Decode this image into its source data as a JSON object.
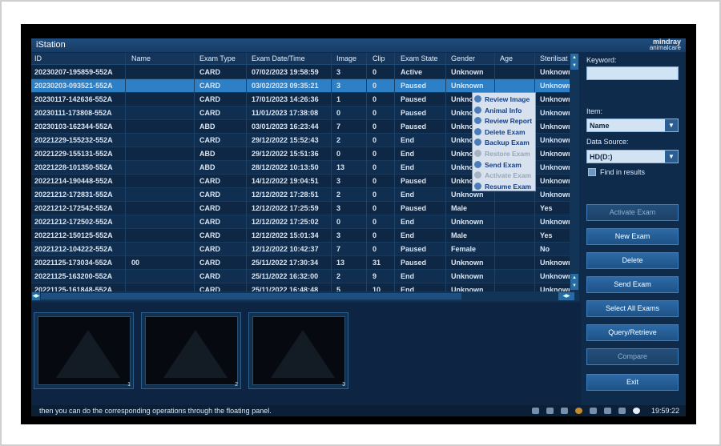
{
  "window": {
    "title": "iStation",
    "logo_line1": "mindray",
    "logo_line2": "animalcare"
  },
  "table": {
    "columns": [
      "ID",
      "Name",
      "Exam Type",
      "Exam Date/Time",
      "Image",
      "Clip",
      "Exam State",
      "Gender",
      "Age",
      "Sterilisat"
    ],
    "rows": [
      [
        "20230207-195859-552A",
        "",
        "CARD",
        "07/02/2023 19:58:59",
        "3",
        "0",
        "Active",
        "Unknown",
        "",
        "Unknown"
      ],
      [
        "20230203-093521-552A",
        "",
        "CARD",
        "03/02/2023 09:35:21",
        "3",
        "0",
        "Paused",
        "Unknown",
        "",
        "Unknown"
      ],
      [
        "20230117-142636-552A",
        "",
        "CARD",
        "17/01/2023 14:26:36",
        "1",
        "0",
        "Paused",
        "Unkno",
        "",
        "Unknown"
      ],
      [
        "20230111-173808-552A",
        "",
        "CARD",
        "11/01/2023 17:38:08",
        "0",
        "0",
        "Paused",
        "Unkno",
        "",
        "Unknown"
      ],
      [
        "20230103-162344-552A",
        "",
        "ABD",
        "03/01/2023 16:23:44",
        "7",
        "0",
        "Paused",
        "Unkno",
        "",
        "Unknown"
      ],
      [
        "20221229-155232-552A",
        "",
        "CARD",
        "29/12/2022 15:52:43",
        "2",
        "0",
        "End",
        "Unkno",
        "",
        "Unknown"
      ],
      [
        "20221229-155131-552A",
        "",
        "ABD",
        "29/12/2022 15:51:36",
        "0",
        "0",
        "End",
        "Unkno",
        "",
        "Unknown"
      ],
      [
        "20221228-101350-552A",
        "",
        "ABD",
        "28/12/2022 10:13:50",
        "13",
        "0",
        "End",
        "Unkno",
        "",
        "Unknown"
      ],
      [
        "20221214-190448-552A",
        "",
        "CARD",
        "14/12/2022 19:04:51",
        "3",
        "0",
        "Paused",
        "Unkno",
        "",
        "Unknown"
      ],
      [
        "20221212-172831-552A",
        "",
        "CARD",
        "12/12/2022 17:28:51",
        "2",
        "0",
        "End",
        "Unknown",
        "",
        "Unknown"
      ],
      [
        "20221212-172542-552A",
        "",
        "CARD",
        "12/12/2022 17:25:59",
        "3",
        "0",
        "Paused",
        "Male",
        "",
        "Yes"
      ],
      [
        "20221212-172502-552A",
        "",
        "CARD",
        "12/12/2022 17:25:02",
        "0",
        "0",
        "End",
        "Unknown",
        "",
        "Unknown"
      ],
      [
        "20221212-150125-552A",
        "",
        "CARD",
        "12/12/2022 15:01:34",
        "3",
        "0",
        "End",
        "Male",
        "",
        "Yes"
      ],
      [
        "20221212-104222-552A",
        "",
        "CARD",
        "12/12/2022 10:42:37",
        "7",
        "0",
        "Paused",
        "Female",
        "",
        "No"
      ],
      [
        "20221125-173034-552A",
        "00",
        "CARD",
        "25/11/2022 17:30:34",
        "13",
        "31",
        "Paused",
        "Unknown",
        "",
        "Unknown"
      ],
      [
        "20221125-163200-552A",
        "",
        "CARD",
        "25/11/2022 16:32:00",
        "2",
        "9",
        "End",
        "Unknown",
        "",
        "Unknown"
      ],
      [
        "20221125-161848-552A",
        "",
        "CARD",
        "25/11/2022 16:48:48",
        "5",
        "10",
        "End",
        "Unknown",
        "",
        "Unknown"
      ]
    ],
    "selected_row": 1
  },
  "context_menu": {
    "items": [
      {
        "label": "Review Image",
        "enabled": true
      },
      {
        "label": "Animal Info",
        "enabled": true
      },
      {
        "label": "Review Report",
        "enabled": true
      },
      {
        "label": "Delete Exam",
        "enabled": true
      },
      {
        "label": "Backup Exam",
        "enabled": true
      },
      {
        "label": "Restore Exam",
        "enabled": false
      },
      {
        "label": "Send Exam",
        "enabled": true
      },
      {
        "label": "Activate Exam",
        "enabled": false
      },
      {
        "label": "Resume Exam",
        "enabled": true
      }
    ]
  },
  "search": {
    "keyword_label": "Keyword:",
    "keyword_value": "",
    "item_label": "Item:",
    "item_value": "Name",
    "source_label": "Data Source:",
    "source_value": "HD(D:)",
    "find_in_results": "Find in results"
  },
  "buttons": {
    "activate_exam": "Activate Exam",
    "new_exam": "New Exam",
    "delete": "Delete",
    "send_exam": "Send Exam",
    "select_all": "Select All Exams",
    "query_retrieve": "Query/Retrieve",
    "compare": "Compare",
    "exit": "Exit"
  },
  "thumbnails": [
    "1",
    "2",
    "3"
  ],
  "status": {
    "message": "then you can do the corresponding operations through the floating panel.",
    "time": "19:59:22"
  },
  "colors": {
    "selected_row": "#2d80c6",
    "button": "#2d6aa6",
    "background": "#0f2b4b"
  }
}
